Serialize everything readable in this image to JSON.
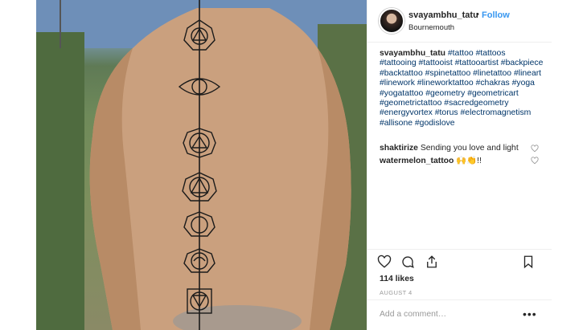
{
  "post": {
    "username": "svayambhu_tatu",
    "separator": "•",
    "follow_label": "Follow",
    "location": "Bournemouth",
    "caption_user": "svayambhu_tatu",
    "caption_tags": [
      "#tattoo",
      "#tattoos",
      "#tattooing",
      "#tattooist",
      "#tattooartist",
      "#backpiece",
      "#backtattoo",
      "#spinetattoo",
      "#linetattoo",
      "#lineart",
      "#linework",
      "#lineworktattoo",
      "#chakras",
      "#yoga",
      "#yogatattoo",
      "#geometry",
      "#geometricart",
      "#geometrictattoo",
      "#sacredgeometry",
      "#energyvortex",
      "#torus",
      "#electromagnetism",
      "#allisone",
      "#godislove"
    ],
    "likes": "114 likes",
    "date": "AUGUST 4",
    "add_comment_placeholder": "Add a comment…",
    "more_label": "•••"
  },
  "comments": [
    {
      "user": "shaktirize",
      "text": "Sending you love and light"
    },
    {
      "user": "watermelon_tattoo",
      "text": "🙌👏!!"
    }
  ],
  "colors": {
    "link": "#003569",
    "follow": "#3897f0",
    "muted": "#999999",
    "text": "#262626"
  },
  "icons": [
    "heart-icon",
    "comment-icon",
    "share-icon",
    "bookmark-icon",
    "more-icon"
  ]
}
